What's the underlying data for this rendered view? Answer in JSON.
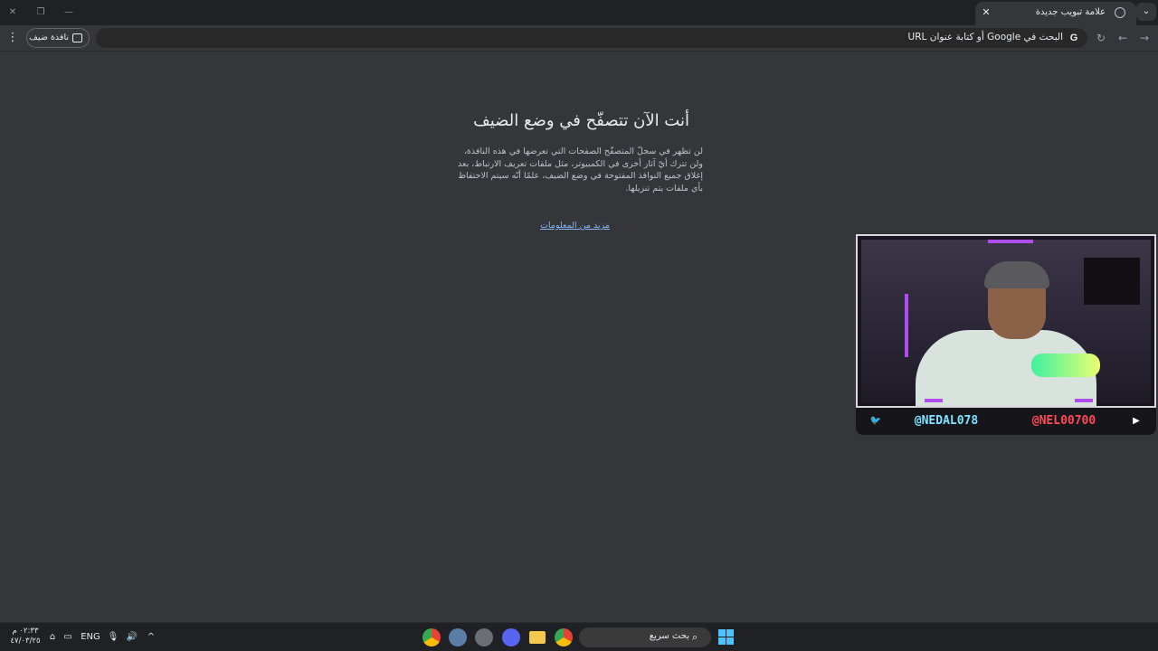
{
  "window": {
    "minimize_glyph": "—",
    "maximize_glyph": "❐",
    "close_glyph": "✕"
  },
  "tabstrip": {
    "tab_title": "علامة تبويب جديدة",
    "tab_close_glyph": "✕",
    "new_tab_glyph": "+",
    "tab_search_glyph": "⌄"
  },
  "toolbar": {
    "omnibox_text": "البحث في Google أو كتابة عنوان URL",
    "google_glyph": "G",
    "back_glyph": "←",
    "forward_glyph": "→",
    "reload_glyph": "↻",
    "guest_label": "نافذة ضيف",
    "menu_glyph": "⋮"
  },
  "page": {
    "title": "أنت الآن تتصفّح في وضع الضيف",
    "description": "لن تظهر في سجلّ المتصفّح الصفحات التي تعرضها في هذه النافذة، ولن تترك أيّ آثار أخرى في الكمبيوتر، مثل ملفات تعريف الارتباط، بعد إغلاق جميع النوافذ المفتوحة في وضع الضيف، علمًا أنّه سيتم الاحتفاظ بأي ملفات يتم تنزيلها.",
    "learn_more": "مزيد من المعلومات"
  },
  "webcam_overlay": {
    "twitter_handle": "@NEDAL078",
    "youtube_handle": "@NEL00700",
    "twitter_glyph": "🐦",
    "youtube_glyph": "▶",
    "accent_color": "#b04cf0"
  },
  "taskbar": {
    "search_label": "بحث سريع",
    "search_glyph": "⌕",
    "language": "ENG",
    "clock_time": "٠٢:٣٣ م",
    "clock_date": "٤٧/٠٣/٢٥",
    "volume_glyph": "🔊",
    "mic_glyph": "🎙",
    "chevron_glyph": "^"
  }
}
